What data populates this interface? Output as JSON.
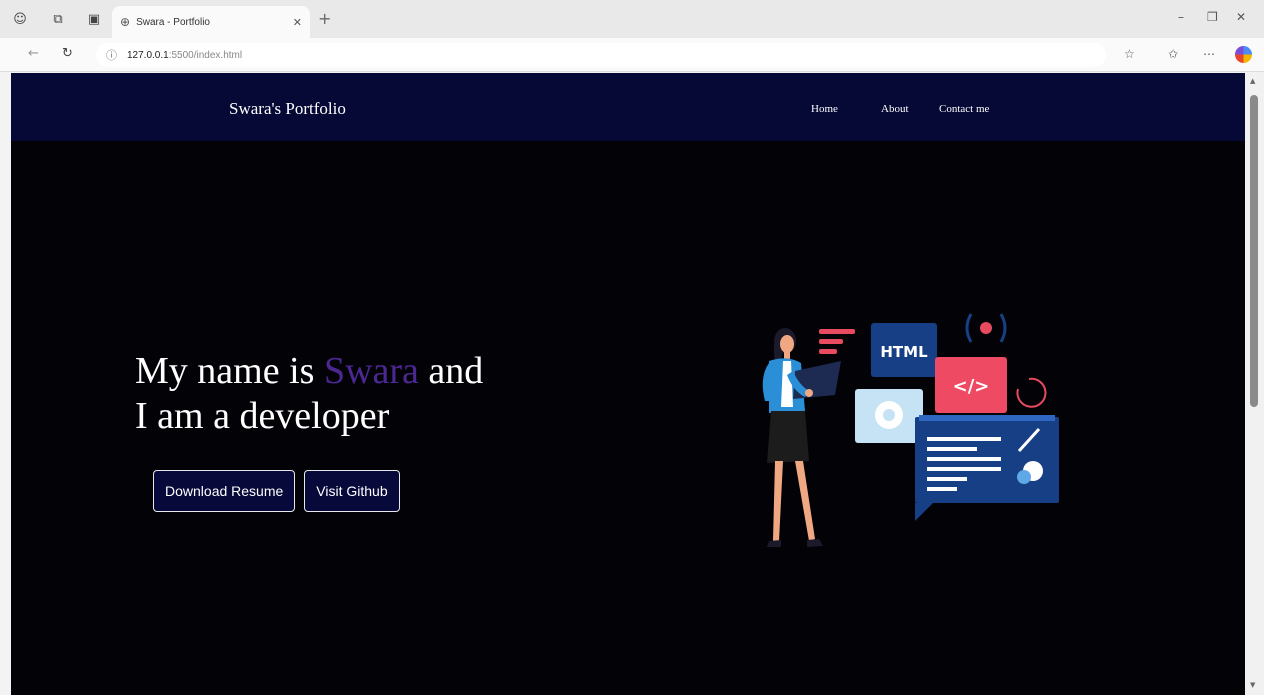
{
  "browser": {
    "tab_title": "Swara - Portfolio",
    "url_host": "127.0.0.1",
    "url_path": ":5500/index.html",
    "icons": {
      "workspaces": "person-icon",
      "tab_actions": "tab-actions-icon",
      "tab_overview": "tab-overview-icon",
      "globe": "globe-icon",
      "close": "close-icon",
      "new_tab": "plus-icon",
      "back": "back-arrow-icon",
      "refresh": "refresh-icon",
      "info": "info-icon",
      "favorite": "star-icon",
      "favorites_bar": "favorites-icon",
      "more": "more-icon",
      "profile": "profile-icon"
    }
  },
  "site": {
    "brand": "Swara's Portfolio",
    "nav": {
      "home": "Home",
      "about": "About",
      "contact": "Contact me"
    },
    "hero": {
      "line1_prefix": "My name is ",
      "name": "Swara",
      "line1_suffix": " and",
      "line2": "I am a developer"
    },
    "buttons": {
      "download_resume": "Download Resume",
      "visit_github": "Visit Github"
    },
    "illustration": {
      "html_label": "HTML",
      "code_label": "</>"
    },
    "colors": {
      "nav_bg": "#060835",
      "page_bg": "#030207",
      "accent": "#4b2791",
      "button_bg": "#07093a"
    }
  }
}
